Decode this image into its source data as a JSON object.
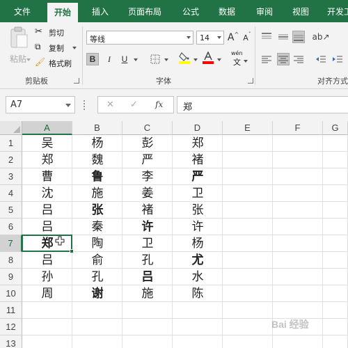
{
  "tabs": [
    {
      "label": "文件",
      "active": false
    },
    {
      "label": "开始",
      "active": true
    },
    {
      "label": "插入",
      "active": false
    },
    {
      "label": "页面布局",
      "active": false
    },
    {
      "label": "公式",
      "active": false
    },
    {
      "label": "数据",
      "active": false
    },
    {
      "label": "审阅",
      "active": false
    },
    {
      "label": "视图",
      "active": false
    },
    {
      "label": "开发工",
      "active": false
    }
  ],
  "clipboard": {
    "paste_label": "粘贴",
    "cut_label": "剪切",
    "copy_label": "复制",
    "format_painter_label": "格式刷",
    "group_label": "剪贴板"
  },
  "font": {
    "name": "等线",
    "size": "14",
    "grow_label": "A",
    "shrink_label": "A",
    "bold_label": "B",
    "italic_label": "I",
    "underline_label": "U",
    "wen_label": "wén",
    "wen_char": "文",
    "group_label": "字体",
    "fill_color": "#ffff00",
    "font_color": "#ff0000"
  },
  "alignment": {
    "group_label": "对齐方式"
  },
  "formula_bar": {
    "name_box": "A7",
    "fx_label": "fx",
    "cancel_icon": "close-icon",
    "enter_icon": "check-icon",
    "content": "郑"
  },
  "columns": [
    "A",
    "B",
    "C",
    "D",
    "E",
    "F",
    "G"
  ],
  "rows": [
    {
      "num": "1",
      "cells": [
        {
          "v": "吴"
        },
        {
          "v": "杨"
        },
        {
          "v": "彭"
        },
        {
          "v": "郑"
        }
      ]
    },
    {
      "num": "2",
      "cells": [
        {
          "v": "郑"
        },
        {
          "v": "魏"
        },
        {
          "v": "严"
        },
        {
          "v": "褚"
        }
      ]
    },
    {
      "num": "3",
      "cells": [
        {
          "v": "曹"
        },
        {
          "v": "鲁",
          "bold": true
        },
        {
          "v": "李"
        },
        {
          "v": "严",
          "bold": true
        }
      ]
    },
    {
      "num": "4",
      "cells": [
        {
          "v": "沈"
        },
        {
          "v": "施"
        },
        {
          "v": "姜"
        },
        {
          "v": "卫"
        }
      ]
    },
    {
      "num": "5",
      "cells": [
        {
          "v": "吕"
        },
        {
          "v": "张",
          "bold": true
        },
        {
          "v": "褚"
        },
        {
          "v": "张"
        }
      ]
    },
    {
      "num": "6",
      "cells": [
        {
          "v": "吕"
        },
        {
          "v": "秦"
        },
        {
          "v": "许",
          "bold": true
        },
        {
          "v": "许"
        }
      ]
    },
    {
      "num": "7",
      "cells": [
        {
          "v": "郑",
          "bold": true
        },
        {
          "v": "陶"
        },
        {
          "v": "卫"
        },
        {
          "v": "杨"
        }
      ]
    },
    {
      "num": "8",
      "cells": [
        {
          "v": "吕"
        },
        {
          "v": "俞"
        },
        {
          "v": "孔"
        },
        {
          "v": "尤",
          "bold": true
        }
      ]
    },
    {
      "num": "9",
      "cells": [
        {
          "v": "孙"
        },
        {
          "v": "孔"
        },
        {
          "v": "吕",
          "bold": true
        },
        {
          "v": "水"
        }
      ]
    },
    {
      "num": "10",
      "cells": [
        {
          "v": "周"
        },
        {
          "v": "谢",
          "bold": true
        },
        {
          "v": "施"
        },
        {
          "v": "陈"
        }
      ]
    },
    {
      "num": "11",
      "cells": []
    },
    {
      "num": "12",
      "cells": []
    },
    {
      "num": "13",
      "cells": []
    }
  ],
  "selected": {
    "col": "A",
    "row": "7"
  },
  "accent_color": "#217346",
  "watermark": "Bai 经验"
}
